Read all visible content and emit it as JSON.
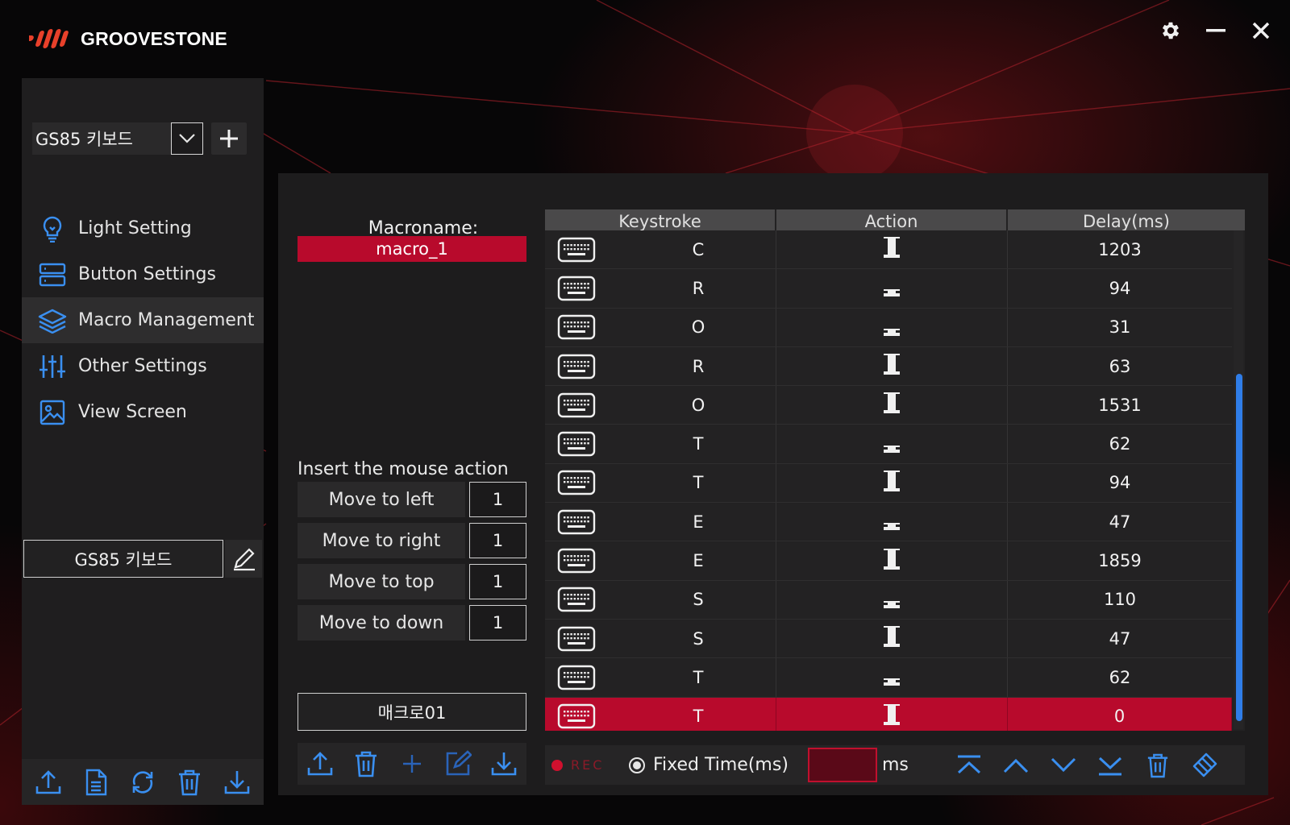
{
  "app": {
    "brand": "GROOVESTONE"
  },
  "colors": {
    "accent_red": "#b80a2c",
    "accent_blue": "#2f7de8",
    "panel": "#1d1c1d",
    "sidebar": "#1f1e1f"
  },
  "window_controls": [
    "gear-icon",
    "minimize-icon",
    "close-icon"
  ],
  "sidebar": {
    "device": "GS85 키보드",
    "profile": "GS85 키보드",
    "nav": [
      {
        "label": "Light Setting",
        "icon": "lightbulb-icon"
      },
      {
        "label": "Button Settings",
        "icon": "server-icon"
      },
      {
        "label": "Macro Management",
        "icon": "layers-icon",
        "active": true
      },
      {
        "label": "Other Settings",
        "icon": "sliders-icon"
      },
      {
        "label": "View Screen",
        "icon": "image-icon"
      }
    ],
    "tools": [
      "upload-icon",
      "file-icon",
      "refresh-icon",
      "trash-icon",
      "download-icon"
    ]
  },
  "macro": {
    "name_label": "Macroname:",
    "name_value": "macro_1",
    "mouse_title": "Insert the mouse action",
    "mouse_actions": [
      {
        "label": "Move to left",
        "value": "1"
      },
      {
        "label": "Move to right",
        "value": "1"
      },
      {
        "label": "Move to top",
        "value": "1"
      },
      {
        "label": "Move to down",
        "value": "1"
      }
    ],
    "list_item": "매크로01",
    "tools": [
      "upload-icon",
      "trash-icon",
      "plus-icon",
      "edit-icon",
      "download-icon"
    ]
  },
  "table": {
    "headers": [
      "Keystroke",
      "Action",
      "Delay(ms)"
    ],
    "rows": [
      {
        "key": "C",
        "action": "press",
        "delay": "1203"
      },
      {
        "key": "R",
        "action": "release",
        "delay": "94"
      },
      {
        "key": "O",
        "action": "release",
        "delay": "31"
      },
      {
        "key": "R",
        "action": "press",
        "delay": "63"
      },
      {
        "key": "O",
        "action": "press",
        "delay": "1531"
      },
      {
        "key": "T",
        "action": "release",
        "delay": "62"
      },
      {
        "key": "T",
        "action": "press",
        "delay": "94"
      },
      {
        "key": "E",
        "action": "release",
        "delay": "47"
      },
      {
        "key": "E",
        "action": "press",
        "delay": "1859"
      },
      {
        "key": "S",
        "action": "release",
        "delay": "110"
      },
      {
        "key": "S",
        "action": "press",
        "delay": "47"
      },
      {
        "key": "T",
        "action": "release",
        "delay": "62"
      },
      {
        "key": "T",
        "action": "press",
        "delay": "0",
        "selected": true
      }
    ]
  },
  "record_bar": {
    "rec_label": "REC",
    "fixed_label": "Fixed Time(ms)",
    "ms_value": "",
    "ms_label": "ms",
    "tools": [
      "move-top-icon",
      "move-up-icon",
      "move-down-icon",
      "move-bottom-icon",
      "trash-icon",
      "eraser-icon"
    ]
  }
}
